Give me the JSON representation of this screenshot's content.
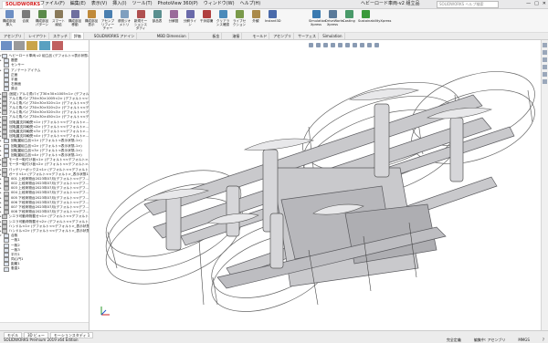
{
  "app": {
    "logo": "SOLIDWORKS",
    "document_title": "ヘビーロード車両-v2 組立品",
    "search_placeholder": "SOLIDWORKS ヘルプ検索"
  },
  "menu": [
    "ファイル(F)",
    "編集(E)",
    "表示(V)",
    "挿入(I)",
    "ツール(T)",
    "PhotoView 360(P)",
    "ウィンドウ(W)",
    "ヘルプ(H)"
  ],
  "window_controls": [
    "—",
    "□",
    "✕"
  ],
  "ribbon": {
    "buttons": [
      {
        "label": "構成部品挿入",
        "color": "#6d8fc4"
      },
      {
        "label": "合致",
        "color": "#7a7a7a"
      },
      {
        "label": "構成部品パターン",
        "color": "#5b8a4a"
      },
      {
        "label": "スマート締結",
        "color": "#8a7a5a"
      },
      {
        "label": "構成部品移動",
        "color": "#6f6f9f"
      },
      {
        "label": "構成部品表示",
        "color": "#c08a3a"
      },
      {
        "label": "アセンブリフィーチャー",
        "color": "#4a7fb0"
      },
      {
        "label": "参照ジオメトリ",
        "color": "#7f9fbf"
      },
      {
        "label": "新規モーションスタディ",
        "color": "#b05050"
      },
      {
        "label": "部品表",
        "color": "#5a8f8f"
      },
      {
        "label": "分解図",
        "color": "#9a6a9a"
      },
      {
        "label": "分解ライン",
        "color": "#6a6aaa"
      },
      {
        "label": "干渉認識",
        "color": "#b04040"
      },
      {
        "label": "クリアランス確認",
        "color": "#4a8aba"
      },
      {
        "label": "ライブセクション",
        "color": "#7a9a4a"
      },
      {
        "label": "外観",
        "color": "#aa8a4a"
      },
      {
        "label": "Instant3D",
        "color": "#4a6aaa"
      },
      {
        "label": "Simulation Xpress",
        "color": "#3a7ab0"
      },
      {
        "label": "DriveWorks Xpress",
        "color": "#5a7a9a"
      },
      {
        "label": "Costing",
        "color": "#4a9a6a"
      },
      {
        "label": "SustainabilityXpress",
        "color": "#3a9a3a"
      }
    ]
  },
  "command_tabs": [
    "アセンブリ",
    "レイアウト",
    "スケッチ",
    "評価",
    "SOLIDWORKS アドイン",
    "MBD Dimension",
    "板金",
    "溶接",
    "モールド",
    "アセンブリ",
    "サーフェス",
    "Simulation"
  ],
  "feature_tree": {
    "items": [
      {
        "label": "ヘビーロード車両-v2 組立品 (デフォルト<表示状態-1>)",
        "toggle": "▾",
        "type": "assy"
      },
      {
        "label": "履歴",
        "toggle": "▸",
        "type": "folder"
      },
      {
        "label": "センサー",
        "toggle": "",
        "type": "folder"
      },
      {
        "label": "アノテートアイテム",
        "toggle": "▸",
        "type": "folder"
      },
      {
        "label": "正面",
        "toggle": "",
        "type": "plane"
      },
      {
        "label": "平面",
        "toggle": "",
        "type": "plane"
      },
      {
        "label": "右側面",
        "toggle": "",
        "type": "plane"
      },
      {
        "label": "原点",
        "toggle": "",
        "type": "plane"
      },
      {
        "label": "(固定) アルミ角パイプ30×30×1005<1> (デフォルト<<デフォルト>_表示状態1>)",
        "toggle": "▸",
        "type": "part"
      },
      {
        "label": "アルミ角パイプ30×30×1005<2> (デフォルト<<デ...",
        "toggle": "▸",
        "type": "part"
      },
      {
        "label": "アルミ角パイプ30×30×520<1> (デフォルト<<デ...",
        "toggle": "▸",
        "type": "part"
      },
      {
        "label": "アルミ角パイプ30×30×520<2> (デフォルト<<デ...",
        "toggle": "▸",
        "type": "part"
      },
      {
        "label": "アルミ角パイプ30×30×520<3> (デフォルト<<デ...",
        "toggle": "▸",
        "type": "part"
      },
      {
        "label": "アルミ角パイプ30×30×450<1> (デフォルト<<デ...",
        "toggle": "▸",
        "type": "part"
      },
      {
        "label": "回転翼支持軸受<1> (デフォルト<<デフォルト>...",
        "toggle": "▸",
        "type": "part"
      },
      {
        "label": "回転翼支持軸受<2> (デフォルト<<デフォルト>...",
        "toggle": "▸",
        "type": "part"
      },
      {
        "label": "回転翼支持軸受<3> (デフォルト<<デフォルト>...",
        "toggle": "▸",
        "type": "part"
      },
      {
        "label": "回転翼支持軸受<4> (デフォルト<<デフォルト>...",
        "toggle": "▸",
        "type": "part"
      },
      {
        "label": "回転翼組立品<1> (デフォルト<表示状態-1>)",
        "toggle": "▸",
        "type": "assy"
      },
      {
        "label": "回転翼組立品<2> (デフォルト<表示状態-1>)",
        "toggle": "▸",
        "type": "assy"
      },
      {
        "label": "回転翼組立品<3> (デフォルト<表示状態-1>)",
        "toggle": "▸",
        "type": "assy"
      },
      {
        "label": "回転翼組立品<4> (デフォルト<表示状態-1>)",
        "toggle": "▸",
        "type": "assy"
      },
      {
        "label": "モーター取付け板<1> (デフォルト<<デフォルト>...",
        "toggle": "▸",
        "type": "part"
      },
      {
        "label": "モーター取付け板<2> (デフォルト<<デフォルト>...",
        "toggle": "▸",
        "type": "part"
      },
      {
        "label": "バッテリーボックス<1> (デフォルト<<デフォルト>...",
        "toggle": "▸",
        "type": "part"
      },
      {
        "label": "ガード<1> (デフォルト<<デフォルト>_表示状態1>)",
        "toggle": "▸",
        "type": "part"
      },
      {
        "label": "001 上段荷物台2023年07月(デフォルト<<デフ...",
        "toggle": "▸",
        "type": "part"
      },
      {
        "label": "002 上段荷物台2023年07月(デフォルト<<デフ...",
        "toggle": "▸",
        "type": "part"
      },
      {
        "label": "003 上段荷物台2023年07月(デフォルト<<デフ...",
        "toggle": "▸",
        "type": "part"
      },
      {
        "label": "004 上段荷物台2023年07月(デフォルト<<デフ...",
        "toggle": "▸",
        "type": "part"
      },
      {
        "label": "005 下段荷物台2023年07月(デフォルト<<デフ...",
        "toggle": "▸",
        "type": "part"
      },
      {
        "label": "006 下段荷物台2023年07月(デフォルト<<デフ...",
        "toggle": "▸",
        "type": "part"
      },
      {
        "label": "007 下段荷物台2023年07月(デフォルト<<デフ...",
        "toggle": "▸",
        "type": "part"
      },
      {
        "label": "008 下段荷物台2023年07月(デフォルト<<デフ...",
        "toggle": "▸",
        "type": "part"
      },
      {
        "label": "シエラ可動荷物載せ<1> (デフォルト<<デフォルト>...",
        "toggle": "▸",
        "type": "part"
      },
      {
        "label": "シエラ可動荷物載せ<2> (デフォルト<<デフォルト>...",
        "toggle": "▸",
        "type": "part"
      },
      {
        "label": "ハンドル<1> (デフォルト<<デフォルト>_表示状態1>)",
        "toggle": "▸",
        "type": "part"
      },
      {
        "label": "ハンドル<2> (デフォルト<<デフォルト>_表示状態1>)",
        "toggle": "▸",
        "type": "part"
      },
      {
        "label": "合致",
        "toggle": "▾",
        "type": "mates"
      },
      {
        "label": "一致1",
        "toggle": "",
        "type": "mate"
      },
      {
        "label": "一致2",
        "toggle": "",
        "type": "mate"
      },
      {
        "label": "一致3",
        "toggle": "",
        "type": "mate"
      },
      {
        "label": "平行1",
        "toggle": "",
        "type": "mate"
      },
      {
        "label": "同心円1",
        "toggle": "",
        "type": "mate"
      },
      {
        "label": "距離1",
        "toggle": "",
        "type": "mate"
      },
      {
        "label": "垂直1",
        "toggle": "",
        "type": "mate"
      }
    ]
  },
  "model_tabs": [
    "モデル",
    "3D ビュー",
    "モーションスタディ 1"
  ],
  "status": {
    "left": "SOLIDWORKS Premium 2019 x64 Edition",
    "right": [
      "完全定義",
      "編集中: アセンブリ",
      "MMGS",
      "?"
    ]
  }
}
